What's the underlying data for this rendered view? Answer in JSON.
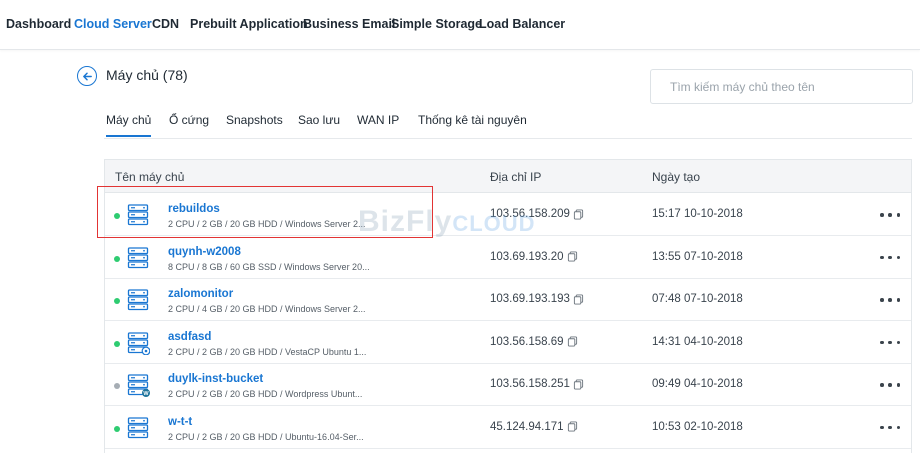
{
  "nav": {
    "items": [
      {
        "label": "Dashboard",
        "active": false
      },
      {
        "label": "Cloud Server",
        "active": true
      },
      {
        "label": "CDN",
        "active": false
      },
      {
        "label": "Prebuilt Application",
        "active": false
      },
      {
        "label": "Business Email",
        "active": false
      },
      {
        "label": "Simple Storage",
        "active": false
      },
      {
        "label": "Load Balancer",
        "active": false
      }
    ]
  },
  "page": {
    "title": "Máy chủ (78)",
    "search_placeholder": "Tìm kiếm máy chủ theo tên"
  },
  "tabs": [
    {
      "label": "Máy chủ",
      "active": true
    },
    {
      "label": "Ổ cứng",
      "active": false
    },
    {
      "label": "Snapshots",
      "active": false
    },
    {
      "label": "Sao lưu",
      "active": false
    },
    {
      "label": "WAN IP",
      "active": false
    },
    {
      "label": "Thống kê tài nguyên",
      "active": false
    }
  ],
  "table": {
    "headers": {
      "name": "Tên máy chủ",
      "ip": "Địa chỉ IP",
      "created": "Ngày tạo"
    },
    "rows": [
      {
        "name": "rebuildos",
        "spec": "2 CPU / 2 GB / 20 GB HDD / Windows Server 2...",
        "ip": "103.56.158.209",
        "created": "15:17 10-10-2018",
        "status": "running",
        "badge": "none"
      },
      {
        "name": "quynh-w2008",
        "spec": "8 CPU / 8 GB / 60 GB SSD / Windows Server 20...",
        "ip": "103.69.193.20",
        "created": "13:55 07-10-2018",
        "status": "running",
        "badge": "none"
      },
      {
        "name": "zalomonitor",
        "spec": "2 CPU / 4 GB / 20 GB HDD / Windows Server 2...",
        "ip": "103.69.193.193",
        "created": "07:48 07-10-2018",
        "status": "running",
        "badge": "none"
      },
      {
        "name": "asdfasd",
        "spec": "2 CPU / 2 GB / 20 GB HDD / VestaCP Ubuntu 1...",
        "ip": "103.56.158.69",
        "created": "14:31 04-10-2018",
        "status": "running",
        "badge": "gear"
      },
      {
        "name": "duylk-inst-bucket",
        "spec": "2 CPU / 2 GB / 20 GB HDD / Wordpress Ubunt...",
        "ip": "103.56.158.251",
        "created": "09:49 04-10-2018",
        "status": "stopped",
        "badge": "wordpress"
      },
      {
        "name": "w-t-t",
        "spec": "2 CPU / 2 GB / 20 GB HDD / Ubuntu-16.04-Ser...",
        "ip": "45.124.94.171",
        "created": "10:53 02-10-2018",
        "status": "running",
        "badge": "none"
      }
    ]
  },
  "colors": {
    "accent": "#1976d2",
    "status_running": "#2ecc71",
    "status_stopped": "#a6adb4",
    "highlight": "#e23434"
  },
  "icons": {
    "back": "arrow-left-circle-icon",
    "server": "server-icon",
    "copy": "copy-icon",
    "more": "more-horizontal-icon"
  },
  "watermark": {
    "main": "BizFly",
    "sub": "CLOUD"
  }
}
